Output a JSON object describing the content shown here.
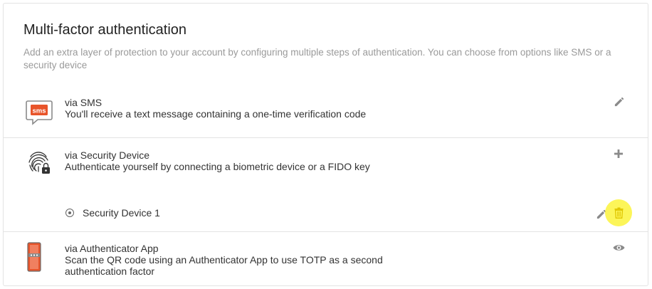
{
  "section": {
    "title": "Multi-factor authentication",
    "description": "Add an extra layer of protection to your account by configuring multiple steps of authentication. You can choose from options like SMS or a security device"
  },
  "methods": [
    {
      "name": "via SMS",
      "description": "You'll receive a text message containing a one-time verification code",
      "icon": "sms-icon",
      "icon_text": "sms",
      "action_icon": "pencil-icon"
    },
    {
      "name": "via Security Device",
      "description": "Authenticate yourself by connecting a biometric device or a FIDO key",
      "icon": "fingerprint-lock-icon",
      "action_icon": "plus-icon",
      "devices": [
        {
          "label": "Security Device 1",
          "actions": [
            "pencil-icon",
            "trash-icon"
          ]
        }
      ]
    },
    {
      "name": "via Authenticator App",
      "description_line1": "Scan the QR code using an Authenticator App to use TOTP as a second",
      "description_line2": "authentication factor",
      "icon": "authenticator-phone-icon",
      "action_icon": "eye-icon"
    }
  ],
  "colors": {
    "accent": "#e8542a",
    "highlight": "#fbf33c",
    "icon_gray": "#8a8a8a"
  }
}
